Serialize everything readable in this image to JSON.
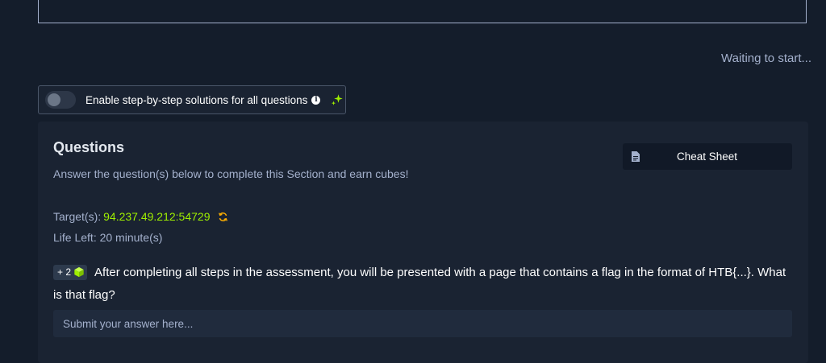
{
  "status_text": "Waiting to start...",
  "toggle": {
    "label": "Enable step-by-step solutions for all questions",
    "enabled": false,
    "info_icon": "info-icon",
    "sparkle_icon": "sparkle-icon"
  },
  "questions": {
    "title": "Questions",
    "subtitle": "Answer the question(s) below to complete this Section and earn cubes!",
    "cheat_sheet_label": "Cheat Sheet",
    "target_label": "Target(s):",
    "target_value": "94.237.49.212:54729",
    "life_label": "Life Left: 20 minute(s)",
    "items": [
      {
        "badge": "+ 2",
        "text": "After completing all steps in the assessment, you will be presented with a page that contains a flag in the format of HTB{...}. What is that flag?",
        "answer_placeholder": "Submit your answer here..."
      }
    ]
  },
  "colors": {
    "background": "#141d2b",
    "panel": "#1a2332",
    "accent_green": "#9fef00",
    "muted_text": "#a4b1cd",
    "refresh_orange": "#ffaf00"
  }
}
